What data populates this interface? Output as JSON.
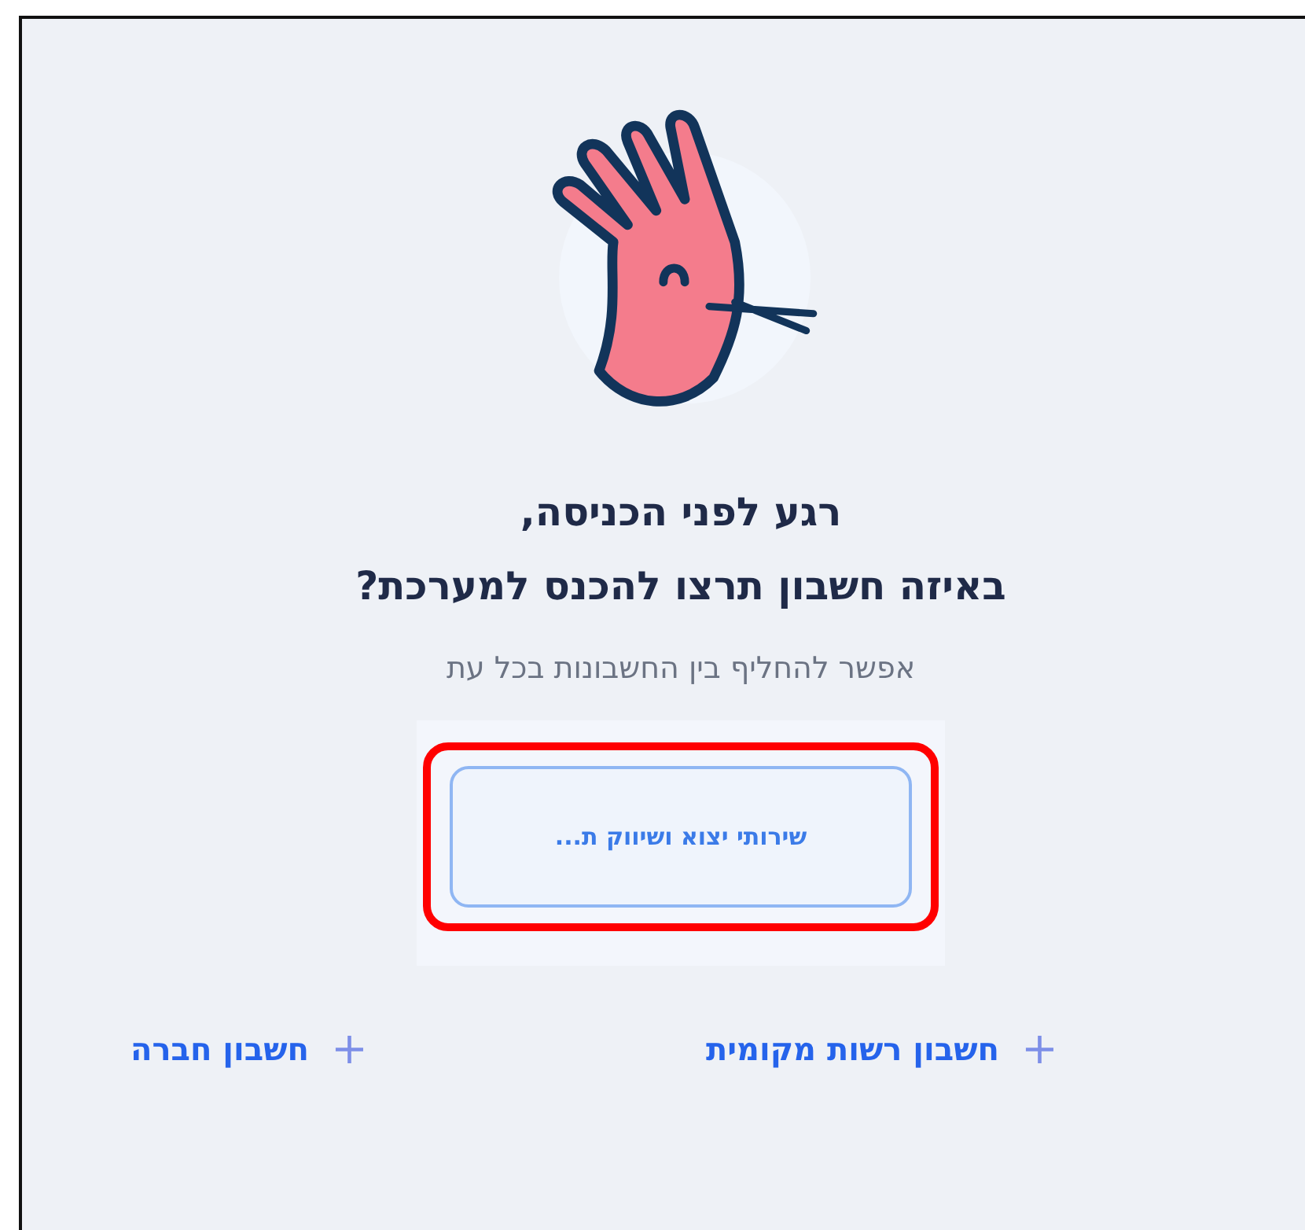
{
  "heading_lines": [
    "רגע לפני הכניסה,",
    "באיזה חשבון תרצו להכנס למערכת?"
  ],
  "subtitle": "אפשר להחליף בין החשבונות בכל עת",
  "accounts": [
    {
      "label": "שירותי יצוא ושיווק ת...",
      "highlighted": true
    }
  ],
  "add_links": [
    {
      "icon": "+",
      "label": "חשבון רשות מקומית"
    },
    {
      "icon": "+",
      "label": "חשבון חברה"
    }
  ]
}
